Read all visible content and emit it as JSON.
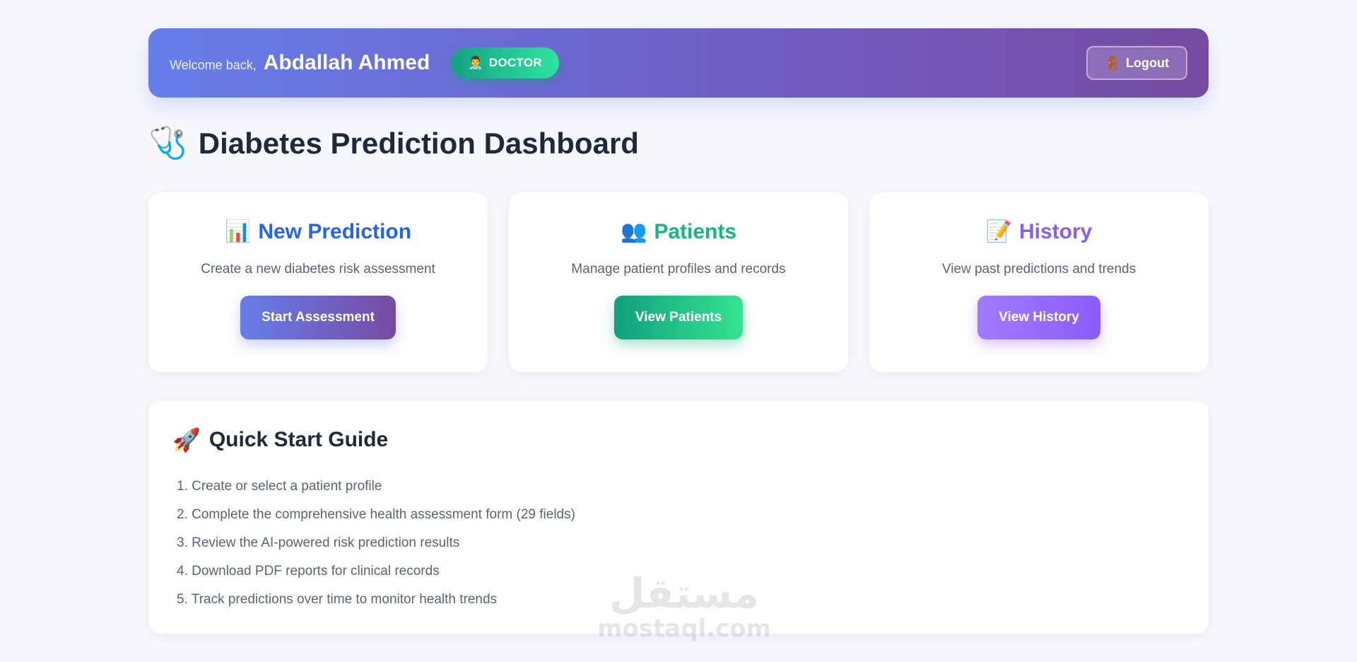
{
  "header": {
    "welcome": "Welcome back,",
    "username": "Abdallah Ahmed",
    "role_icon": "👨‍⚕️",
    "role": "DOCTOR",
    "logout_icon": "🚪",
    "logout": "Logout"
  },
  "dashboard": {
    "title_icon": "🩺",
    "title": "Diabetes Prediction Dashboard"
  },
  "cards": [
    {
      "icon": "📊",
      "title": "New Prediction",
      "description": "Create a new diabetes risk assessment",
      "button": "Start Assessment",
      "color": "#2563eb"
    },
    {
      "icon": "👥",
      "title": "Patients",
      "description": "Manage patient profiles and records",
      "button": "View Patients",
      "color": "#10b981"
    },
    {
      "icon": "📝",
      "title": "History",
      "description": "View past predictions and trends",
      "button": "View History",
      "color": "#8b5cf6"
    }
  ],
  "guide": {
    "icon": "🚀",
    "title": "Quick Start Guide",
    "steps": [
      "1. Create or select a patient profile",
      "2. Complete the comprehensive health assessment form (29 fields)",
      "3. Review the AI-powered risk prediction results",
      "4. Download PDF reports for clinical records",
      "5. Track predictions over time to monitor health trends"
    ]
  },
  "watermark": {
    "arabic": "مستقل",
    "latin": "mostaql.com"
  }
}
